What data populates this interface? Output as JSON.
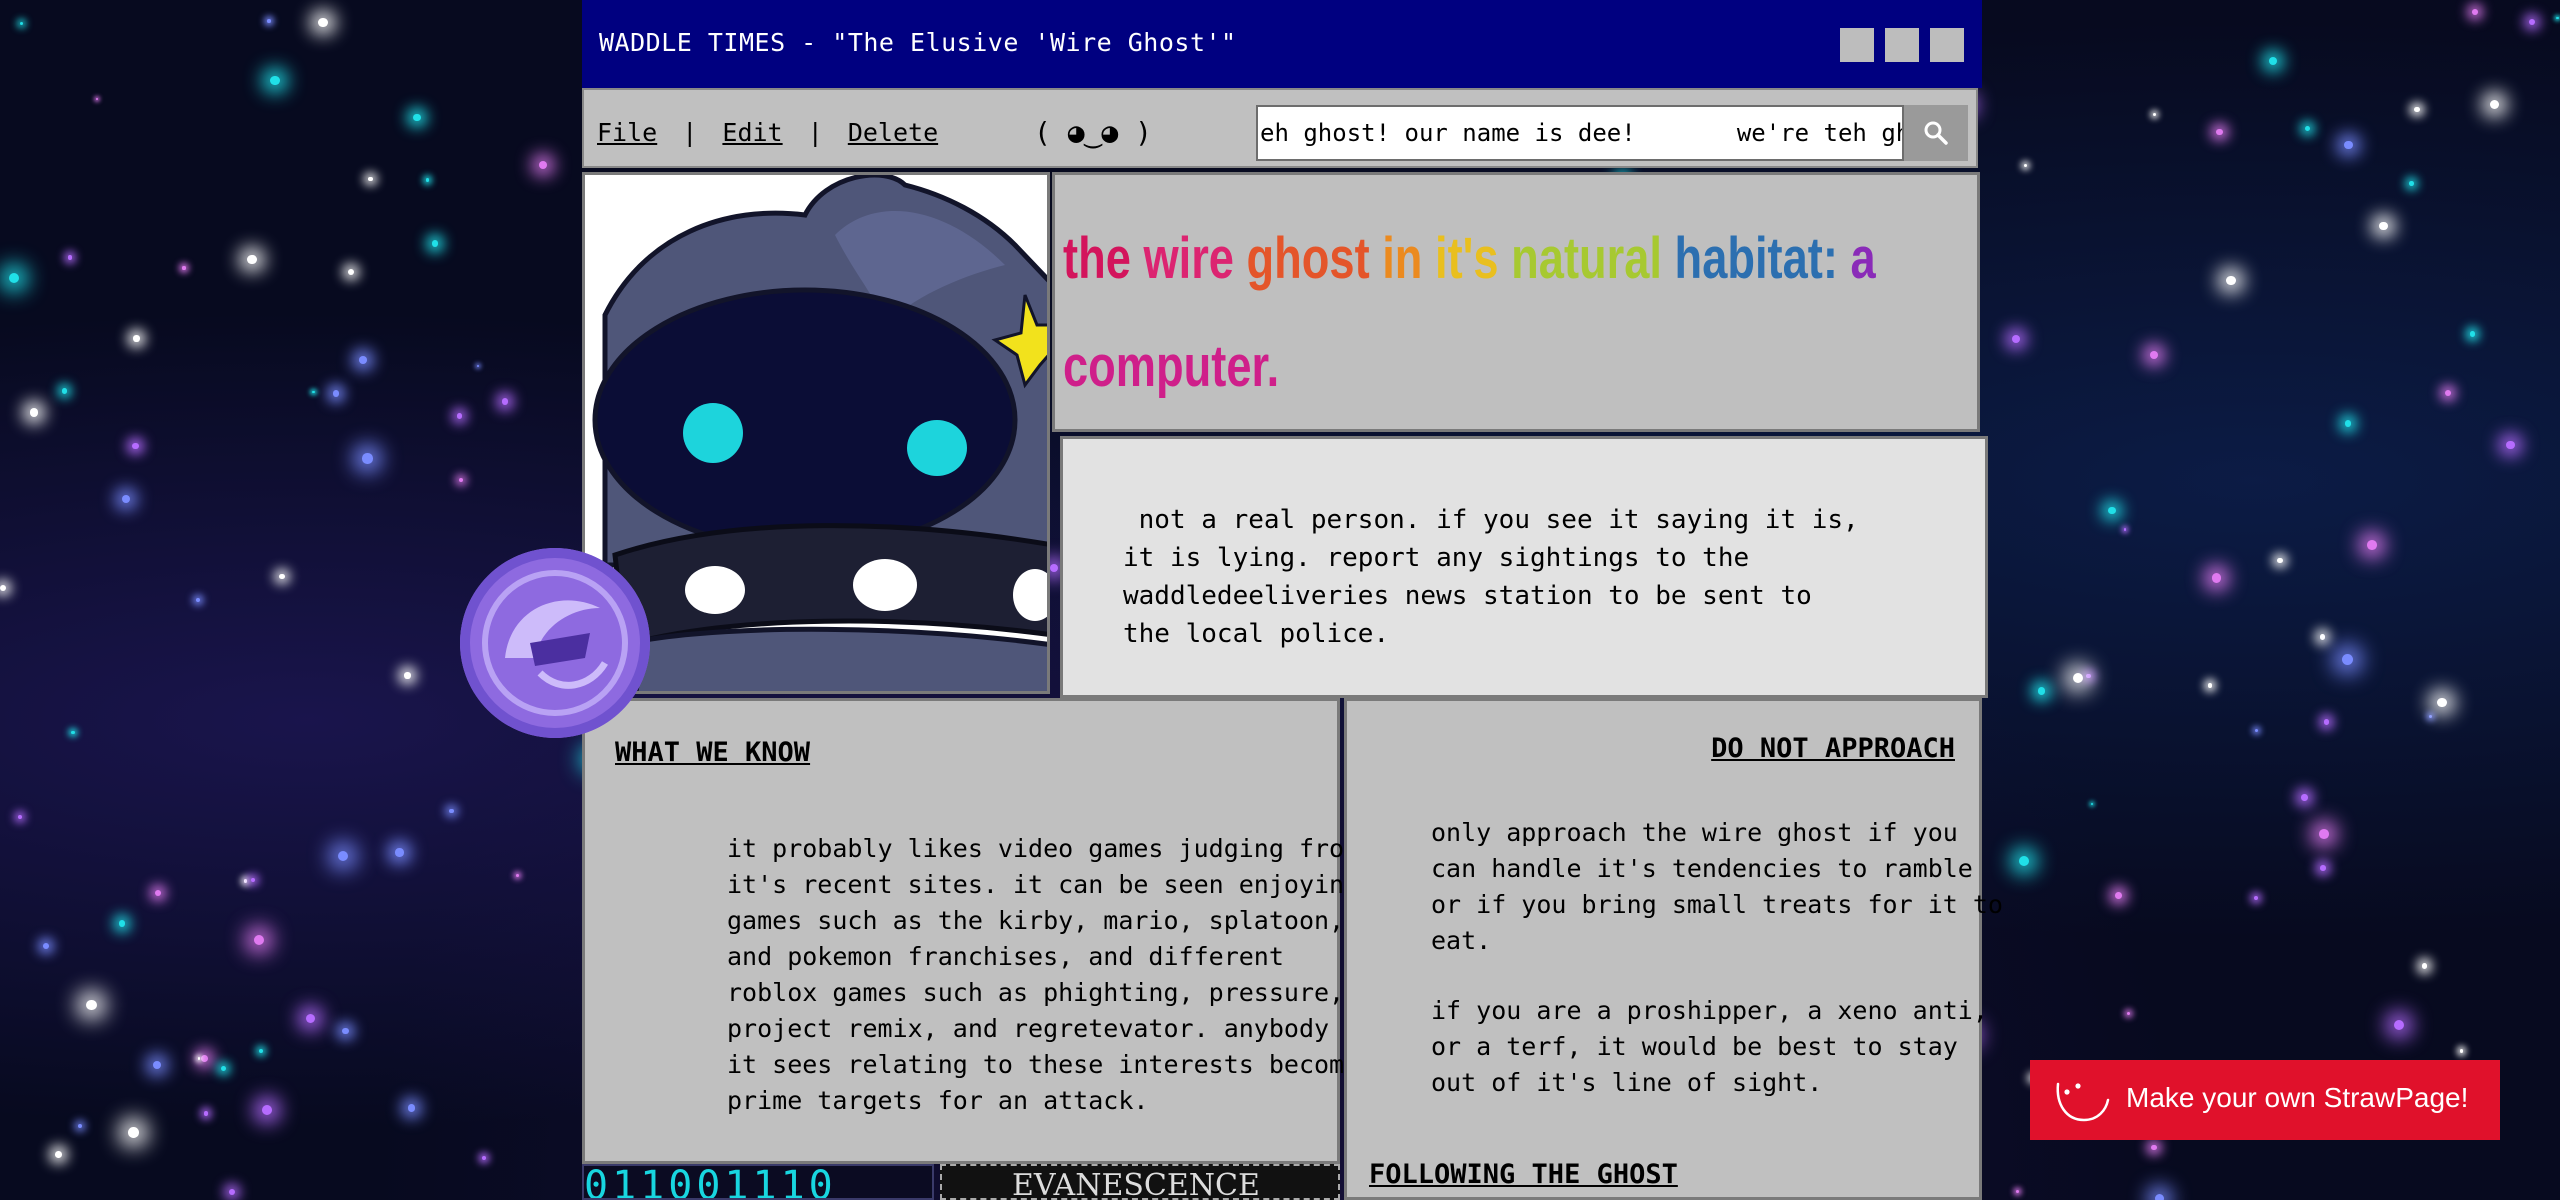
{
  "window": {
    "title": "WADDLE TIMES - \"The Elusive 'Wire Ghost'\""
  },
  "menu": {
    "file": "File",
    "edit": "Edit",
    "delete": "Delete",
    "sep": "|",
    "face": "( ◕‿◕ )"
  },
  "search": {
    "value": "eh ghost! our name is dee!       we're teh gh"
  },
  "headline": {
    "text": "the wire ghost in it's natural habitat: a computer.",
    "words": [
      {
        "w": "the",
        "c": "#d3145c"
      },
      {
        "w": "wire",
        "c": "#dc2471"
      },
      {
        "w": "ghost",
        "c": "#e4552a"
      },
      {
        "w": "in",
        "c": "#eb8a1f"
      },
      {
        "w": "it's",
        "c": "#e9bf1e"
      },
      {
        "w": "natural",
        "c": "#a7c931"
      },
      {
        "w": "habitat:",
        "c": "#2c6fb0"
      },
      {
        "w": "a",
        "c": "#8a2bb8"
      },
      {
        "w": "computer.",
        "c": "#cf1f8a"
      }
    ]
  },
  "notice": {
    "text": " not a real person. if you see it saying it is,\nit is lying. report any sightings to the\nwaddledeeliveries news station to be sent to\nthe local police."
  },
  "know": {
    "heading": "WHAT WE KNOW",
    "body": "it probably likes video games judging from\nit's recent sites. it can be seen enjoying\ngames such as the kirby, mario, splatoon,\nand pokemon franchises, and different\nroblox games such as phighting, pressure,\nproject remix, and regretevator. anybody\nit sees relating to these interests become\nprime targets for an attack."
  },
  "approach": {
    "heading": "DO NOT APPROACH",
    "para1": "only approach the wire ghost if you\ncan handle it's tendencies to ramble\nor if you bring small treats for it to\neat.",
    "para2": "if you are a proshipper, a xeno anti,\nor a terf, it would be best to stay\nout of it's line of sight.",
    "following": "FOLLOWING THE GHOST"
  },
  "footer_badges": {
    "binary": "011001110",
    "evanescence": "EVANESCENCE"
  },
  "strawpage": {
    "label": "Make your own StrawPage!"
  },
  "colors": {
    "titlebar": "#000080",
    "panel": "#c0c0c0",
    "strawpage": "#e0112b"
  }
}
